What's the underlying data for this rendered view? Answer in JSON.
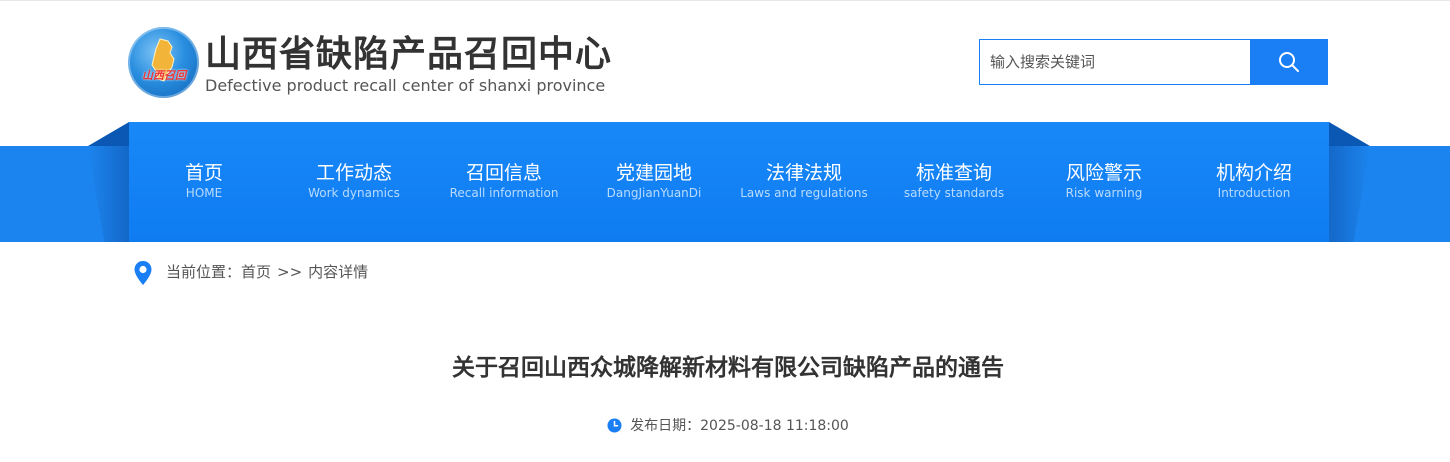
{
  "header": {
    "logo": {
      "icon": "province-map-logo-icon",
      "text": "山西召回"
    },
    "title": "山西省缺陷产品召回中心",
    "subtitle": "Defective product recall center of shanxi province"
  },
  "search": {
    "placeholder": "输入搜索关键词",
    "button_icon": "search-icon"
  },
  "nav": {
    "items": [
      {
        "cn": "首页",
        "en": "HOME"
      },
      {
        "cn": "工作动态",
        "en": "Work dynamics"
      },
      {
        "cn": "召回信息",
        "en": "Recall information"
      },
      {
        "cn": "党建园地",
        "en": "DangJianYuanDi"
      },
      {
        "cn": "法律法规",
        "en": "Laws and regulations"
      },
      {
        "cn": "标准查询",
        "en": "safety standards"
      },
      {
        "cn": "风险警示",
        "en": "Risk warning"
      },
      {
        "cn": "机构介绍",
        "en": "Introduction"
      }
    ]
  },
  "breadcrumb": {
    "icon": "location-pin-icon",
    "prefix": "当前位置：",
    "home": "首页",
    "separator": ">>",
    "current": "内容详情"
  },
  "article": {
    "title": "关于召回山西众城降解新材料有限公司缺陷产品的通告",
    "date_icon": "clock-icon",
    "date_label": "发布日期：",
    "date_value": "2025-08-18 11:18:00"
  },
  "colors": {
    "accent": "#1a7ff5",
    "nav_bg": "#0f7cf2",
    "nav_dark": "#0a58b4",
    "text": "#333333"
  }
}
